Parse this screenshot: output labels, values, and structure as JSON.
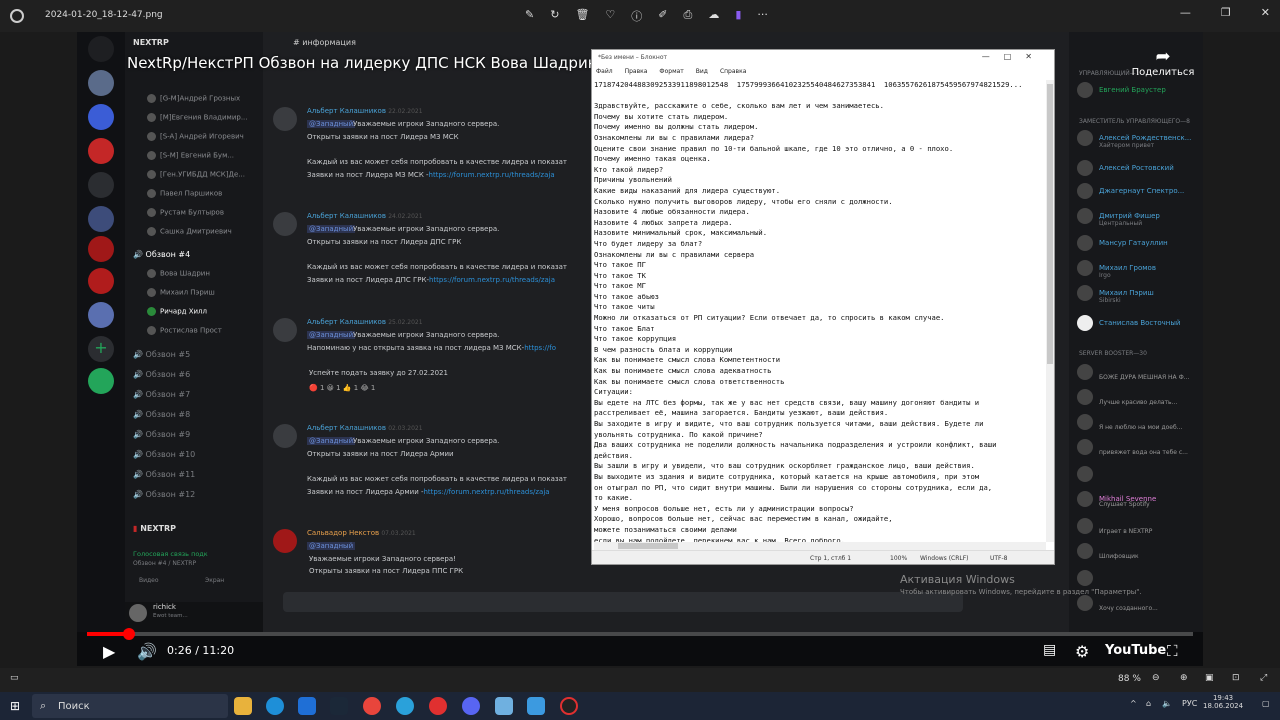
{
  "viewer": {
    "file_name": "2024-01-20_18-12-47.png",
    "zoom": "88 %"
  },
  "video": {
    "title": "NextRp/НекстРП Обзвон на лидерку ДПС НСК Вова Шадрин (прошел)",
    "share_label": "Поделиться",
    "time": "0:26 / 11:20",
    "progress_fraction": 0.038,
    "brand": "YouTube"
  },
  "discord": {
    "server_name": "NEXTRP",
    "channel_header": "информация",
    "voice_users_top": [
      "[G-M]Андрей Грозных",
      "[M]Евгения Владимир...",
      "[S-A] Андрей Игоревич",
      "[S-M] Евгений Бум...",
      "[Ген.УГИБДД МСК]Де...",
      "Павел Паршиков",
      "Рустам Бултыров",
      "Сашка Дмитриевич"
    ],
    "active_channel": "Обзвон #4",
    "active_users": [
      "Вова Шадрин",
      "Михаил Пэриш",
      "Ричард Хилл",
      "Ростислав Прост"
    ],
    "channels": [
      "Обзвон #5",
      "Обзвон #6",
      "Обзвон #7",
      "Обзвон #8",
      "Обзвон #9",
      "Обзвон #10",
      "Обзвон #11",
      "Обзвон #12"
    ],
    "footer_server": "NEXTRP",
    "voice_status": "Голосовая связь подк",
    "voice_sub": "Обзвон #4 / NEXTRP",
    "video_btn": "Видео",
    "screen_btn": "Экран",
    "user_name": "richick",
    "user_tag": "Ewot team...",
    "messages": [
      {
        "author": "Альберт Калашников",
        "time": "22.02.2021",
        "mention": "@Западный",
        "l1": "Уважаемые игроки Западного сервера.",
        "l2": "Открыты заявки на пост Лидера МЗ МСК",
        "l3": "Каждый из вас может себя попробовать в качестве лидера и показат",
        "l4a": "Заявки на пост Лидера МЗ МСК -",
        "l4b": "https://forum.nextrp.ru/threads/zaja"
      },
      {
        "author": "Альберт Калашников",
        "time": "24.02.2021",
        "mention": "@Западный",
        "l1": "Уважаемые игроки Западного сервера.",
        "l2": "Открыты заявки на пост Лидера ДПС ГРК",
        "l3": "Каждый из вас может себя попробовать в качестве лидера и показат",
        "l4a": "Заявки на пост Лидера ДПС ГРК-",
        "l4b": "https://forum.nextrp.ru/threads/zaja"
      },
      {
        "author": "Альберт Калашников",
        "time": "25.02.2021",
        "mention": "@Западный",
        "l1": "Уважаемые игроки Западного сервера.",
        "l2": "Напоминаю у нас открыта заявка на пост лидера МЗ МСК-",
        "l2b": "https://fo",
        "l3": "Успейте подать заявку до 27.02.2021"
      },
      {
        "author": "Альберт Калашников",
        "time": "02.03.2021",
        "mention": "@Западный",
        "l1": "Уважаемые игроки Западного сервера.",
        "l2": "Открыты заявки на пост Лидера Армии",
        "l3": "Каждый из вас может себя попробовать в качестве лидера и показат",
        "l4a": "Заявки на пост Лидера Армии -",
        "l4b": "https://forum.nextrp.ru/threads/zaja"
      },
      {
        "author": "Сальвадор Некстов",
        "time": "07.03.2021",
        "mention": "@Западный",
        "l1": "Уважаемые игроки Западного сервера!",
        "l2": "Открыты заявки на пост Лидера ППС ГРК"
      }
    ],
    "members": {
      "h1": "УПРАВЛЯЮЩИЙ—1",
      "m1": "Евгений Браустер",
      "h2": "ЗАМЕСТИТЕЛЬ УПРАВЛЯЮЩЕГО—8",
      "list": [
        {
          "name": "Алексей Рождественск...",
          "status": "Хайтером привет"
        },
        {
          "name": "Алексей Ростовский",
          "status": ""
        },
        {
          "name": "Джагернаут Спектро...",
          "status": ""
        },
        {
          "name": "Дмитрий Фишер",
          "status": "Центральный"
        },
        {
          "name": "Мансур Гатауллин",
          "status": ""
        },
        {
          "name": "Михаил Громов",
          "status": "Irgo"
        },
        {
          "name": "Михаил Пэриш",
          "status": "Sibirski"
        },
        {
          "name": "Станислав Восточный",
          "status": ""
        }
      ],
      "h3": "SERVER BOOSTER—30",
      "boosters": [
        {
          "name": "",
          "status": "БОЖЕ ДУРА МЕШНАЯ НА Ф..."
        },
        {
          "name": "",
          "status": "Лучше красиво делать..."
        },
        {
          "name": "",
          "status": "Я не люблю на мои доеб..."
        },
        {
          "name": "",
          "status": "привяжет вода она тебе с..."
        },
        {
          "name": "",
          "status": ""
        },
        {
          "name": "Mikhail Sevenne",
          "status": "Слушает Spotify"
        },
        {
          "name": "",
          "status": "Играет в NEXTRP"
        },
        {
          "name": "",
          "status": "Шлифовщик"
        },
        {
          "name": "",
          "status": ""
        },
        {
          "name": "",
          "status": "Хочу созданного..."
        }
      ]
    }
  },
  "notepad": {
    "title": "*Без имени – Блокнот",
    "menu": [
      "Файл",
      "Правка",
      "Формат",
      "Вид",
      "Справка"
    ],
    "status_pos": "Стр 1, стлб 1",
    "status_zoom": "100%",
    "status_eol": "Windows (CRLF)",
    "status_enc": "UTF-8",
    "lines": [
      "171874204488309253391189801254​8  1757999366410232554048462735384​1  10635576261875459567974821529...",
      "",
      "Здравствуйте, расскажите о себе, сколько вам лет и чем занимаетесь.",
      "Почему вы хотите стать лидером.",
      "Почему именно вы должны стать лидером.",
      "Ознакомлены ли вы с правилами лидера?",
      "Оцените свои знание правил по 10-ти бальной шкале, где 10 это отлично, а 0 - плохо.",
      "Почему именно такая оценка.",
      "Кто такой лидер?",
      "Причины увольнений",
      "Какие виды наказаний для лидера существуют.",
      "Сколько нужно получить выговоров лидеру, чтобы его сняли с должности.",
      "Назовите 4 любые обязанности лидера.",
      "Назовите 4 любых запрета лидера.",
      "Назовите минимальный срок, максимальный.",
      "Что будет лидеру за блат?",
      "Ознакомлены ли вы с правилами сервера",
      "Что такое ПГ",
      "Что такое ТК",
      "Что такое МГ",
      "Что такое абьюз",
      "Что такое читы",
      "Можно ли отказаться от РП ситуации? Если отвечает да, то спросить в каком случае.",
      "Что такое Блат",
      "Что такое коррупция",
      "В чем разность блата и коррупции",
      "Как вы понимаете смысл слова Компетентности",
      "Как вы понимаете смысл слова адекватность",
      "Как вы понимаете смысл слова ответственность",
      "Ситуации:",
      "Вы едете на ЛТС без формы, так же у вас нет средств связи, вашу машину догоняют бандиты и",
      "расстреливает её, машина загорается. Бандиты уезжают, ваши действия.",
      "Вы заходите в игру и видите, что ваш сотрудник пользуется читами, ваши действия. Будете ли",
      "увольнять сотрудника. По какой причине?",
      "Два ваших сотрудника не поделили должность начальника подразделения и устроили конфликт, ваши",
      "действия.",
      "Вы зашли в игру и увидели, что ваш сотрудник оскорбляет гражданское лицо, ваши действия.",
      "Вы выходите из здания и видите сотрудника, который катается на крыше автомобиля, при этом",
      "он отыграл по РП, что сидит внутри машины. Были ли нарушения со стороны сотрудника, если да,",
      "то какие.",
      "У меня вопросов больше нет, есть ли у администрации вопросы?",
      "Хорошо, вопросов больше нет, сейчас вас переместим в канал, ожидайте,",
      "можете позаниматься своими делами",
      "если вы нам подойдете, перекинем вас к нам. Всего доброго."
    ]
  },
  "activation": {
    "title": "Активация Windows",
    "sub": "Чтобы активировать Windows, перейдите в раздел \"Параметры\"."
  },
  "taskbar": {
    "search": "Поиск",
    "lang": "РУС",
    "time": "19:43",
    "date": "18.06.2024"
  }
}
